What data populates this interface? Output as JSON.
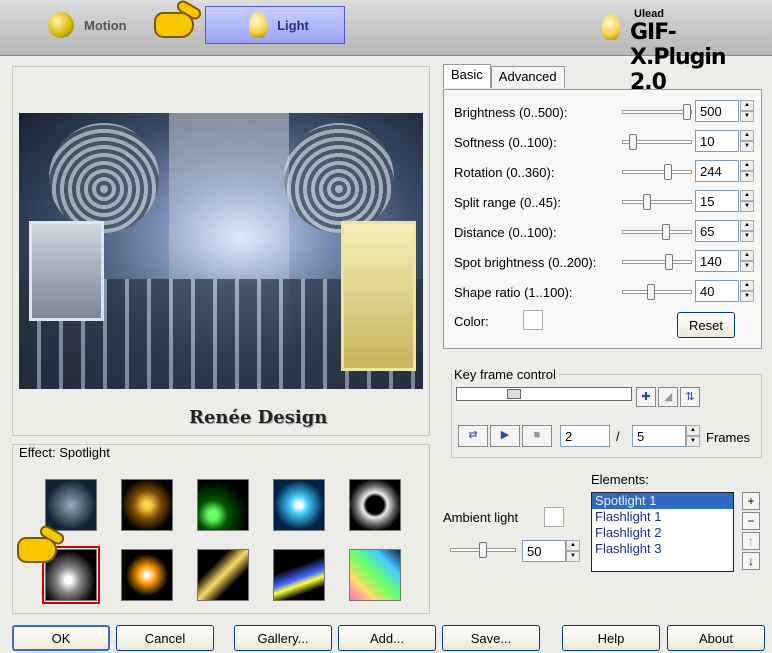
{
  "header": {
    "tabs": [
      {
        "label": "Motion",
        "active": false
      },
      {
        "label": "Light",
        "active": true
      }
    ],
    "brand_small": "Ulead",
    "brand_large": "GIF-X.Plugin 2.0"
  },
  "preview": {
    "watermark": "Renée Design"
  },
  "effects": {
    "label": "Effect: Spotlight",
    "thumbs": [
      "lightning",
      "fireworks",
      "lens-flare",
      "starburst",
      "ring",
      "spotlight",
      "glow",
      "comet",
      "beam",
      "rainbow"
    ],
    "selected_index": 5
  },
  "settings": {
    "tabs": [
      "Basic",
      "Advanced"
    ],
    "active_tab": "Basic",
    "params": [
      {
        "label": "Brightness (0..500):",
        "value": "500",
        "fraction": 1.0
      },
      {
        "label": "Softness (0..100):",
        "value": "10",
        "fraction": 0.1
      },
      {
        "label": "Rotation (0..360):",
        "value": "244",
        "fraction": 0.68
      },
      {
        "label": "Split range (0..45):",
        "value": "15",
        "fraction": 0.33
      },
      {
        "label": "Distance (0..100):",
        "value": "65",
        "fraction": 0.65
      },
      {
        "label": "Spot brightness (0..200):",
        "value": "140",
        "fraction": 0.7
      },
      {
        "label": "Shape ratio (1..100):",
        "value": "40",
        "fraction": 0.4
      }
    ],
    "color_label": "Color:",
    "reset_label": "Reset"
  },
  "keyframe": {
    "label": "Key frame control",
    "current_frame": "2",
    "separator": "/",
    "total_frames": "5",
    "frames_label": "Frames"
  },
  "ambient": {
    "label": "Ambient light",
    "value": "50",
    "fraction": 0.5
  },
  "elements": {
    "label": "Elements:",
    "items": [
      "Spotlight 1",
      "Flashlight 1",
      "Flashlight 2",
      "Flashlight 3"
    ],
    "selected_index": 0
  },
  "buttons": {
    "ok": "OK",
    "cancel": "Cancel",
    "gallery": "Gallery...",
    "add": "Add...",
    "save": "Save...",
    "help": "Help",
    "about": "About"
  }
}
